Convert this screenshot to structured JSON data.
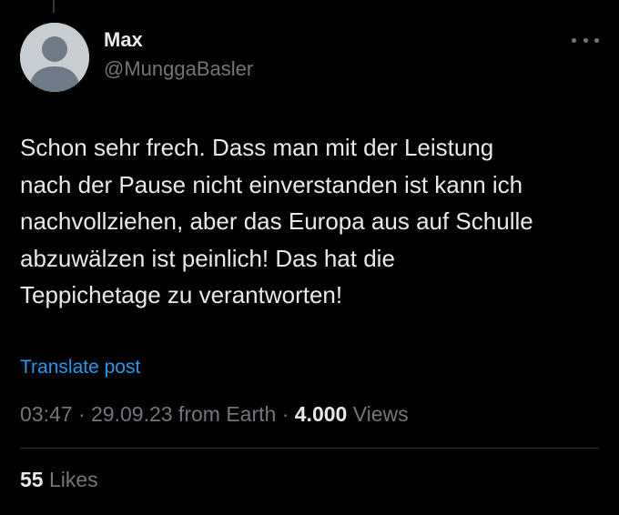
{
  "colors": {
    "background": "#000000",
    "primary_text": "#e7e9ea",
    "secondary_text": "#71767b",
    "link": "#1d9bf0",
    "divider": "#2f3336",
    "avatar_bg": "#c8cdd2",
    "avatar_fg": "#6e7a86"
  },
  "author": {
    "display_name": "Max",
    "handle": "@MunggaBasler",
    "avatar_icon": "default-avatar-icon"
  },
  "menu": {
    "icon": "more-horizontal-icon"
  },
  "tweet": {
    "text": "Schon sehr frech. Dass man mit der Leistung\nnach der Pause nicht einverstanden ist kann ich\nnachvollziehen, aber das Europa aus auf Schulle\nabzuwälzen ist peinlich! Das hat die\nTeppichetage zu verantworten!",
    "translate_label": "Translate post"
  },
  "meta": {
    "time": "03:47",
    "sep1": " · ",
    "date": "29.09.23",
    "location": " from Earth",
    "sep2": " · ",
    "views_count": "4.000",
    "views_label": " Views"
  },
  "engagement": {
    "likes_count": "55",
    "likes_label": " Likes"
  }
}
